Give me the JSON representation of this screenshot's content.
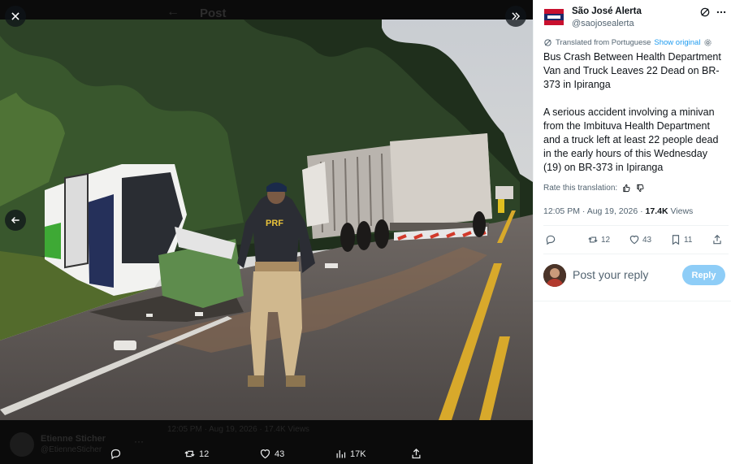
{
  "viewer": {
    "ghost_post_title": "Post",
    "ghost_author_name": "Etienne Sticher",
    "ghost_author_handle": "@EtienneSticher",
    "ghost_meta": "12:05 PM · Aug 19, 2026 · 17.4K Views",
    "actions": {
      "replies": "",
      "reposts": "12",
      "likes": "43",
      "views": "17K"
    },
    "photo_badge": "PRF"
  },
  "author": {
    "name": "São José Alerta",
    "handle": "@saojosealerta"
  },
  "translation": {
    "label": "Translated from Portuguese",
    "show_original": "Show original",
    "rate_label": "Rate this translation:"
  },
  "tweet": {
    "headline": "Bus Crash Between Health Department Van and Truck Leaves 22 Dead on BR-373 in Ipiranga",
    "body": "A serious accident involving a minivan from the Imbituva Health Department and a truck left at least 22 people dead in the early hours of this Wednesday (19) on BR-373 in Ipiranga",
    "time": "12:05 PM · Aug 19, 2026",
    "views_count": "17.4K",
    "views_label": "Views"
  },
  "stats": {
    "replies": "",
    "reposts": "12",
    "likes": "43",
    "bookmarks": "11"
  },
  "reply": {
    "placeholder": "Post your reply",
    "button": "Reply"
  },
  "colors": {
    "accent": "#1d9bf0",
    "reply_button": "#8ecdf7",
    "text": "#0f1419",
    "muted": "#536471"
  },
  "icons": [
    "close-icon",
    "expand-icon",
    "back-arrow-icon",
    "grok-icon",
    "more-icon",
    "settings-icon",
    "thumbs-up-icon",
    "thumbs-down-icon",
    "reply-icon",
    "repost-icon",
    "like-icon",
    "bookmark-icon",
    "share-icon",
    "views-icon"
  ]
}
